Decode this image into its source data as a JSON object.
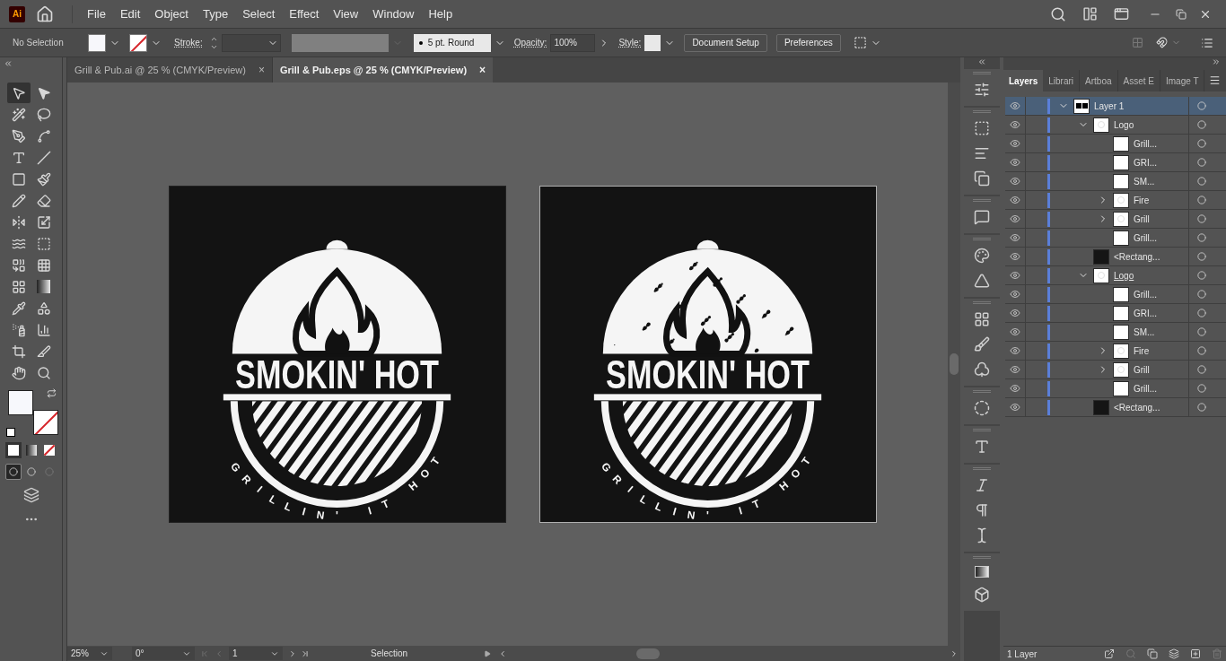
{
  "app": {
    "logo": "Ai"
  },
  "menu": [
    "File",
    "Edit",
    "Object",
    "Type",
    "Select",
    "Effect",
    "View",
    "Window",
    "Help"
  ],
  "control_bar": {
    "selection": "No Selection",
    "stroke_label": "Stroke:",
    "brush": "5 pt. Round",
    "opacity_label": "Opacity:",
    "opacity": "100%",
    "style_label": "Style:",
    "buttons": [
      "Document Setup",
      "Preferences"
    ]
  },
  "document_tabs": [
    {
      "title": "Grill & Pub.ai @ 25 % (CMYK/Preview)",
      "close": "×",
      "selected": false
    },
    {
      "title": "Grill & Pub.eps @ 25 % (CMYK/Preview)",
      "close": "×",
      "selected": true
    }
  ],
  "tools": [
    {
      "kind": "selection",
      "selected": true
    },
    {
      "kind": "direct",
      "selected": false
    },
    {
      "kind": "wand",
      "selected": false
    },
    {
      "kind": "lasso",
      "selected": false
    },
    {
      "kind": "pen",
      "selected": false
    },
    {
      "kind": "curvature",
      "selected": false
    },
    {
      "kind": "type",
      "selected": false
    },
    {
      "kind": "line",
      "selected": false
    },
    {
      "kind": "rectangle",
      "selected": false
    },
    {
      "kind": "brush",
      "selected": false
    },
    {
      "kind": "pencil",
      "selected": false
    },
    {
      "kind": "eraser",
      "selected": false
    },
    {
      "kind": "reflect",
      "selected": false
    },
    {
      "kind": "scale",
      "selected": false
    },
    {
      "kind": "warp",
      "selected": false
    },
    {
      "kind": "transform",
      "selected": false
    },
    {
      "kind": "builder",
      "selected": false
    },
    {
      "kind": "perspective",
      "selected": false
    },
    {
      "kind": "mesh",
      "selected": false
    },
    {
      "kind": "gradient",
      "selected": false
    },
    {
      "kind": "eyedropper",
      "selected": false
    },
    {
      "kind": "blend",
      "selected": false
    },
    {
      "kind": "spray",
      "selected": false
    },
    {
      "kind": "graph",
      "selected": false
    },
    {
      "kind": "artboard",
      "selected": false
    },
    {
      "kind": "slice",
      "selected": false
    },
    {
      "kind": "hand",
      "selected": false
    },
    {
      "kind": "zoom",
      "selected": false
    }
  ],
  "draw_modes": [
    {
      "selected": true
    },
    {
      "selected": false
    },
    {
      "selected": false
    }
  ],
  "artboards": [
    {
      "kind": "clean",
      "selected": false,
      "title": "SMOKIN' HOT",
      "tagline": "GRILLIN' IT HOT"
    },
    {
      "kind": "distressed",
      "selected": true,
      "title": "SMOKIN' HOT",
      "tagline": "GRILLIN' IT HOT"
    }
  ],
  "layers_panel": {
    "tabs": [
      {
        "label": "Layers",
        "selected": true
      },
      {
        "label": "Librari",
        "selected": false
      },
      {
        "label": "Artboa",
        "selected": false
      },
      {
        "label": "Asset E",
        "selected": false
      },
      {
        "label": "Image T",
        "selected": false
      }
    ],
    "layers": [
      {
        "name": "Layer 1",
        "kind": "layer",
        "selected": true,
        "underlined": false,
        "visible": true,
        "expanded": true,
        "children": [
          {
            "name": "Logo",
            "kind": "group",
            "selected": false,
            "underlined": false,
            "visible": true,
            "expanded": true,
            "children": [
              {
                "name": "Grill...",
                "kind": "object",
                "selected": false,
                "underlined": false,
                "visible": true
              },
              {
                "name": "GRI...",
                "kind": "object",
                "selected": false,
                "underlined": false,
                "visible": true
              },
              {
                "name": "SM...",
                "kind": "object",
                "selected": false,
                "underlined": false,
                "visible": true
              },
              {
                "name": "Fire",
                "kind": "group",
                "selected": false,
                "underlined": false,
                "visible": true,
                "expanded": false
              },
              {
                "name": "Grill",
                "kind": "group",
                "selected": false,
                "underlined": false,
                "visible": true,
                "expanded": false
              },
              {
                "name": "Grill...",
                "kind": "object",
                "selected": false,
                "underlined": false,
                "visible": true
              }
            ]
          },
          {
            "name": "<Rectang...",
            "kind": "rect",
            "selected": false,
            "underlined": false,
            "visible": true
          },
          {
            "name": "Logo",
            "kind": "group",
            "selected": false,
            "underlined": true,
            "visible": true,
            "expanded": true,
            "children": [
              {
                "name": "Grill...",
                "kind": "object",
                "selected": false,
                "underlined": false,
                "visible": true
              },
              {
                "name": "GRI...",
                "kind": "object",
                "selected": false,
                "underlined": false,
                "visible": true
              },
              {
                "name": "SM...",
                "kind": "object",
                "selected": false,
                "underlined": false,
                "visible": true
              },
              {
                "name": "Fire",
                "kind": "group",
                "selected": false,
                "underlined": false,
                "visible": true,
                "expanded": false
              },
              {
                "name": "Grill",
                "kind": "group",
                "selected": false,
                "underlined": false,
                "visible": true,
                "expanded": false
              },
              {
                "name": "Grill...",
                "kind": "object",
                "selected": false,
                "underlined": false,
                "visible": true
              }
            ]
          },
          {
            "name": "<Rectang...",
            "kind": "rect",
            "selected": false,
            "underlined": false,
            "visible": true
          }
        ]
      }
    ],
    "footer": "1 Layer"
  },
  "status_bar": {
    "zoom": "25%",
    "rotation": "0°",
    "artboard": "1",
    "tool": "Selection"
  }
}
